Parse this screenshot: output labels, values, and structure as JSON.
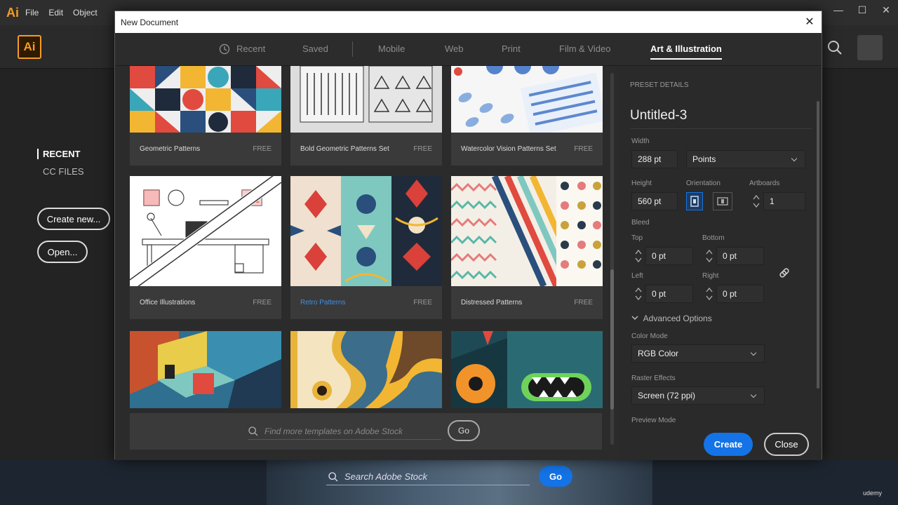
{
  "menubar": {
    "app_glyph": "Ai",
    "items": [
      "File",
      "Edit",
      "Object"
    ],
    "window_controls": [
      "—",
      "☐",
      "✕"
    ]
  },
  "app_header": {
    "logo": "Ai"
  },
  "start_sidebar": {
    "recent": "RECENT",
    "cc_files": "CC FILES",
    "create_new": "Create new...",
    "open": "Open..."
  },
  "stock": {
    "placeholder": "Search Adobe Stock",
    "go": "Go",
    "watermark": "udemy"
  },
  "dialog": {
    "title": "New Document",
    "close_glyph": "✕",
    "tabs": [
      {
        "label": "Recent"
      },
      {
        "label": "Saved"
      },
      {
        "label": "Mobile"
      },
      {
        "label": "Web"
      },
      {
        "label": "Print"
      },
      {
        "label": "Film & Video"
      },
      {
        "label": "Art & Illustration"
      }
    ],
    "active_tab": "Art & Illustration",
    "templates": [
      {
        "name": "Geometric Patterns",
        "badge": "FREE"
      },
      {
        "name": "Bold Geometric Patterns Set",
        "badge": "FREE"
      },
      {
        "name": "Watercolor Vision Patterns Set",
        "badge": "FREE"
      },
      {
        "name": "Office Illustrations",
        "badge": "FREE"
      },
      {
        "name": "Retro Patterns",
        "badge": "FREE"
      },
      {
        "name": "Distressed Patterns",
        "badge": "FREE"
      }
    ],
    "find": {
      "placeholder": "Find more templates on Adobe Stock",
      "go": "Go"
    },
    "preset": {
      "section_label": "PRESET DETAILS",
      "doc_name": "Untitled-3",
      "width_label": "Width",
      "width_value": "288 pt",
      "units": "Points",
      "height_label": "Height",
      "height_value": "560 pt",
      "orientation_label": "Orientation",
      "artboards_label": "Artboards",
      "artboards_value": "1",
      "bleed_label": "Bleed",
      "top_label": "Top",
      "top_value": "0 pt",
      "bottom_label": "Bottom",
      "bottom_value": "0 pt",
      "left_label": "Left",
      "left_value": "0 pt",
      "right_label": "Right",
      "right_value": "0 pt",
      "advanced": "Advanced Options",
      "color_mode_label": "Color Mode",
      "color_mode": "RGB Color",
      "raster_label": "Raster Effects",
      "raster": "Screen (72 ppi)",
      "preview_label": "Preview Mode",
      "create": "Create",
      "close": "Close"
    }
  },
  "colors": {
    "accent": "#1473e6",
    "ai_orange": "#f49b28"
  }
}
